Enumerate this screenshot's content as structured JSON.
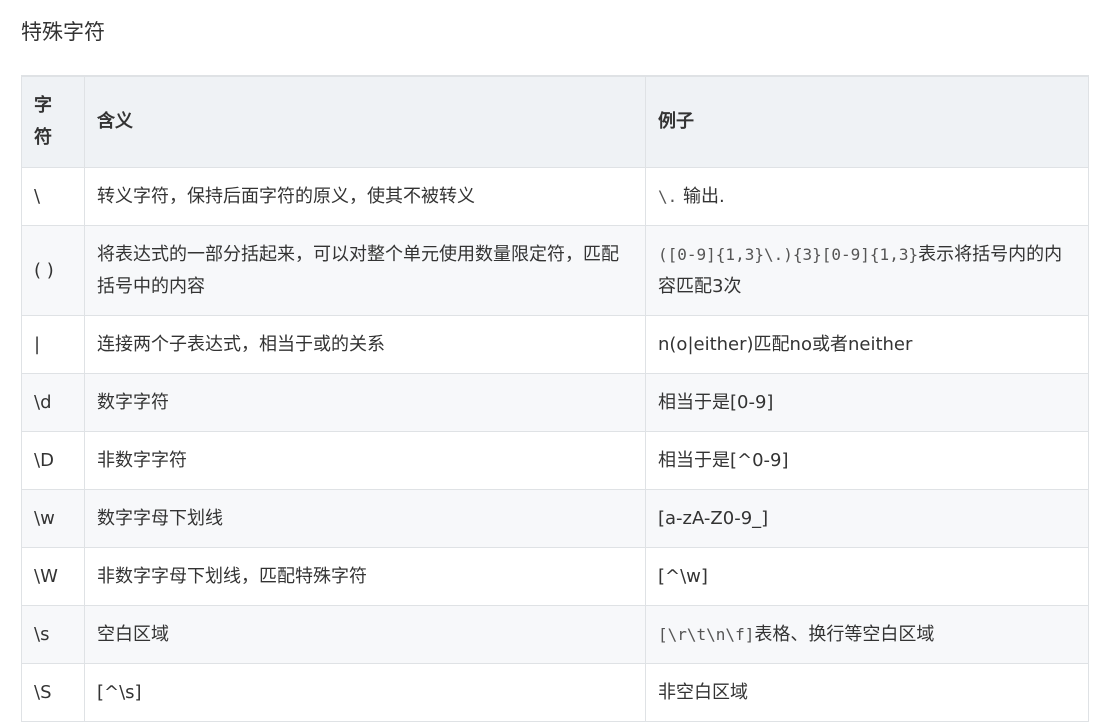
{
  "title": "特殊字符",
  "table": {
    "headers": [
      "字符",
      "含义",
      "例子"
    ],
    "header_symbol_lines": [
      "字",
      "符"
    ],
    "rows": [
      {
        "symbol": "\\",
        "meaning": "转义字符，保持后面字符的原义，使其不被转义",
        "example_code": "\\.",
        "example_text": " 输出."
      },
      {
        "symbol": "( )",
        "meaning": "将表达式的一部分括起来，可以对整个单元使用数量限定符，匹配括号中的内容",
        "example_code": "([0-9]{1,3}\\.){3}[0-9]{1,3}",
        "example_text": "表示将括号内的内容匹配3次"
      },
      {
        "symbol": "|",
        "meaning": "连接两个子表达式，相当于或的关系",
        "example_code": "",
        "example_text": "n(o|either)匹配no或者neither"
      },
      {
        "symbol": "\\d",
        "meaning": "数字字符",
        "example_code": "",
        "example_text": "相当于是[0-9]"
      },
      {
        "symbol": "\\D",
        "meaning": "非数字字符",
        "example_code": "",
        "example_text": "相当于是[^0-9]"
      },
      {
        "symbol": "\\w",
        "meaning": "数字字母下划线",
        "example_code": "",
        "example_text": "[a-zA-Z0-9_]"
      },
      {
        "symbol": "\\W",
        "meaning": "非数字字母下划线，匹配特殊字符",
        "example_code": "",
        "example_text": "[^\\w]"
      },
      {
        "symbol": "\\s",
        "meaning": "空白区域",
        "example_code": "[\\r\\t\\n\\f]",
        "example_text": "表格、换行等空白区域"
      },
      {
        "symbol": "\\S",
        "meaning": "[^\\s]",
        "example_code": "",
        "example_text": "非空白区域"
      }
    ]
  }
}
